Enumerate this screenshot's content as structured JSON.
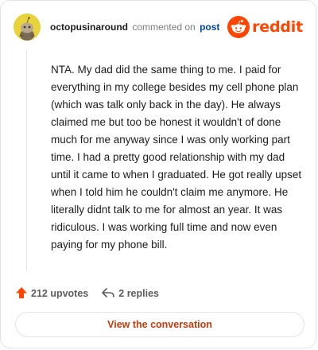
{
  "header": {
    "username": "octopusinaround",
    "action_text": "commented on",
    "post_link_text": "post",
    "brand_name": "reddit",
    "brand_color": "#ff4500",
    "avatar_icon": "snoo-avatar-icon"
  },
  "comment": {
    "body": "NTA. My dad did the same thing to me. I paid for everything in my college besides my cell phone plan (which was talk only back in the day). He always claimed me but too be honest it wouldn't of done much for me anyway since I was only working part time. I had a pretty good relationship with my dad until it came to when I graduated. He got really upset when I told him he couldn't claim me anymore. He literally didnt talk to me for almost an year. It was ridiculous. I was working full time and now even paying for my phone bill."
  },
  "footer": {
    "upvotes_label": "212 upvotes",
    "replies_label": "2 replies",
    "upvote_icon": "upvote-arrow-icon",
    "reply_icon": "reply-arrow-icon",
    "upvote_color": "#ff4500"
  },
  "cta": {
    "label": "View the conversation",
    "color": "#c33a0b"
  }
}
